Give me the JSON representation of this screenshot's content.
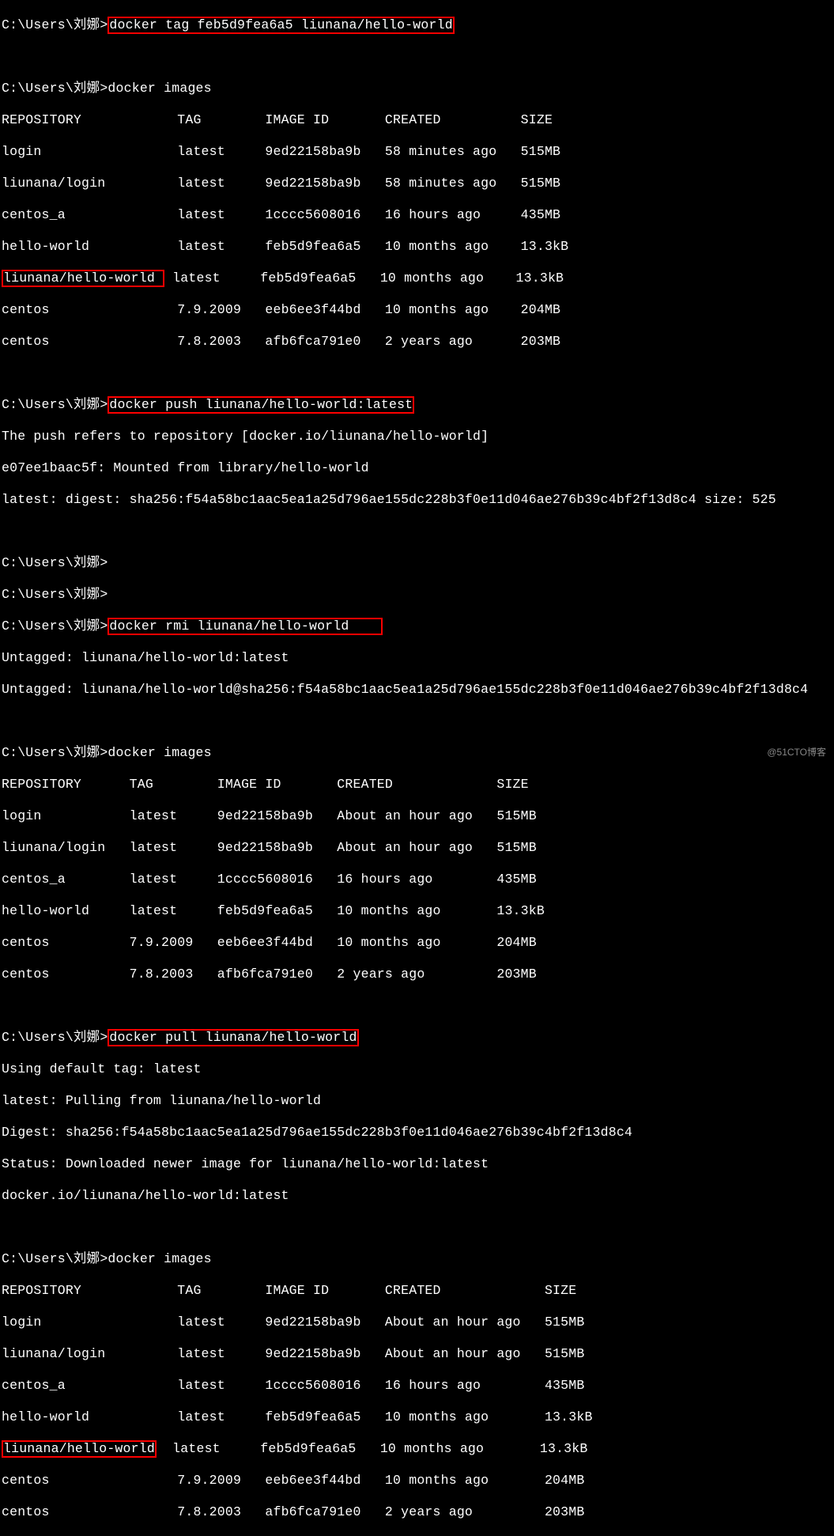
{
  "prompt": "C:\\Users\\刘娜>",
  "cmd": {
    "tag": "docker tag feb5d9fea6a5 liunana/hello-world",
    "images": "docker images",
    "push": "docker push liunana/hello-world:latest",
    "rmi": "docker rmi liunana/hello-world",
    "pull": "docker pull liunana/hello-world"
  },
  "pushOutput": {
    "l1": "The push refers to repository [docker.io/liunana/hello-world]",
    "l2": "e07ee1baac5f: Mounted from library/hello-world",
    "l3": "latest: digest: sha256:f54a58bc1aac5ea1a25d796ae155dc228b3f0e11d046ae276b39c4bf2f13d8c4 size: 525"
  },
  "rmiOutput": {
    "l1": "Untagged: liunana/hello-world:latest",
    "l2": "Untagged: liunana/hello-world@sha256:f54a58bc1aac5ea1a25d796ae155dc228b3f0e11d046ae276b39c4bf2f13d8c4"
  },
  "pullOutput": {
    "l1": "Using default tag: latest",
    "l2": "latest: Pulling from liunana/hello-world",
    "l3": "Digest: sha256:f54a58bc1aac5ea1a25d796ae155dc228b3f0e11d046ae276b39c4bf2f13d8c4",
    "l4": "Status: Downloaded newer image for liunana/hello-world:latest",
    "l5": "docker.io/liunana/hello-world:latest"
  },
  "headers": {
    "repo": "REPOSITORY",
    "tag": "TAG",
    "imageId": "IMAGE ID",
    "created": "CREATED",
    "size": "SIZE"
  },
  "tbl1": {
    "r0": {
      "repo": "login",
      "tag": "latest",
      "id": "9ed22158ba9b",
      "created": "58 minutes ago",
      "size": "515MB"
    },
    "r1": {
      "repo": "liunana/login",
      "tag": "latest",
      "id": "9ed22158ba9b",
      "created": "58 minutes ago",
      "size": "515MB"
    },
    "r2": {
      "repo": "centos_a",
      "tag": "latest",
      "id": "1cccc5608016",
      "created": "16 hours ago",
      "size": "435MB"
    },
    "r3": {
      "repo": "hello-world",
      "tag": "latest",
      "id": "feb5d9fea6a5",
      "created": "10 months ago",
      "size": "13.3kB"
    },
    "r4": {
      "repo": "liunana/hello-world ",
      "tag": "latest",
      "id": "feb5d9fea6a5",
      "created": "10 months ago",
      "size": "13.3kB"
    },
    "r5": {
      "repo": "centos",
      "tag": "7.9.2009",
      "id": "eeb6ee3f44bd",
      "created": "10 months ago",
      "size": "204MB"
    },
    "r6": {
      "repo": "centos",
      "tag": "7.8.2003",
      "id": "afb6fca791e0",
      "created": "2 years ago",
      "size": "203MB"
    }
  },
  "tbl2": {
    "r0": {
      "repo": "login",
      "tag": "latest",
      "id": "9ed22158ba9b",
      "created": "About an hour ago",
      "size": "515MB"
    },
    "r1": {
      "repo": "liunana/login",
      "tag": "latest",
      "id": "9ed22158ba9b",
      "created": "About an hour ago",
      "size": "515MB"
    },
    "r2": {
      "repo": "centos_a",
      "tag": "latest",
      "id": "1cccc5608016",
      "created": "16 hours ago",
      "size": "435MB"
    },
    "r3": {
      "repo": "hello-world",
      "tag": "latest",
      "id": "feb5d9fea6a5",
      "created": "10 months ago",
      "size": "13.3kB"
    },
    "r4": {
      "repo": "centos",
      "tag": "7.9.2009",
      "id": "eeb6ee3f44bd",
      "created": "10 months ago",
      "size": "204MB"
    },
    "r5": {
      "repo": "centos",
      "tag": "7.8.2003",
      "id": "afb6fca791e0",
      "created": "2 years ago",
      "size": "203MB"
    }
  },
  "tbl3": {
    "r0": {
      "repo": "login",
      "tag": "latest",
      "id": "9ed22158ba9b",
      "created": "About an hour ago",
      "size": "515MB"
    },
    "r1": {
      "repo": "liunana/login",
      "tag": "latest",
      "id": "9ed22158ba9b",
      "created": "About an hour ago",
      "size": "515MB"
    },
    "r2": {
      "repo": "centos_a",
      "tag": "latest",
      "id": "1cccc5608016",
      "created": "16 hours ago",
      "size": "435MB"
    },
    "r3": {
      "repo": "hello-world",
      "tag": "latest",
      "id": "feb5d9fea6a5",
      "created": "10 months ago",
      "size": "13.3kB"
    },
    "r4": {
      "repo": "liunana/hello-world",
      "tag": "latest",
      "id": "feb5d9fea6a5",
      "created": "10 months ago",
      "size": "13.3kB"
    },
    "r5": {
      "repo": "centos",
      "tag": "7.9.2009",
      "id": "eeb6ee3f44bd",
      "created": "10 months ago",
      "size": "204MB"
    },
    "r6": {
      "repo": "centos",
      "tag": "7.8.2003",
      "id": "afb6fca791e0",
      "created": "2 years ago",
      "size": "203MB"
    }
  },
  "watermark": "@51CTO博客"
}
